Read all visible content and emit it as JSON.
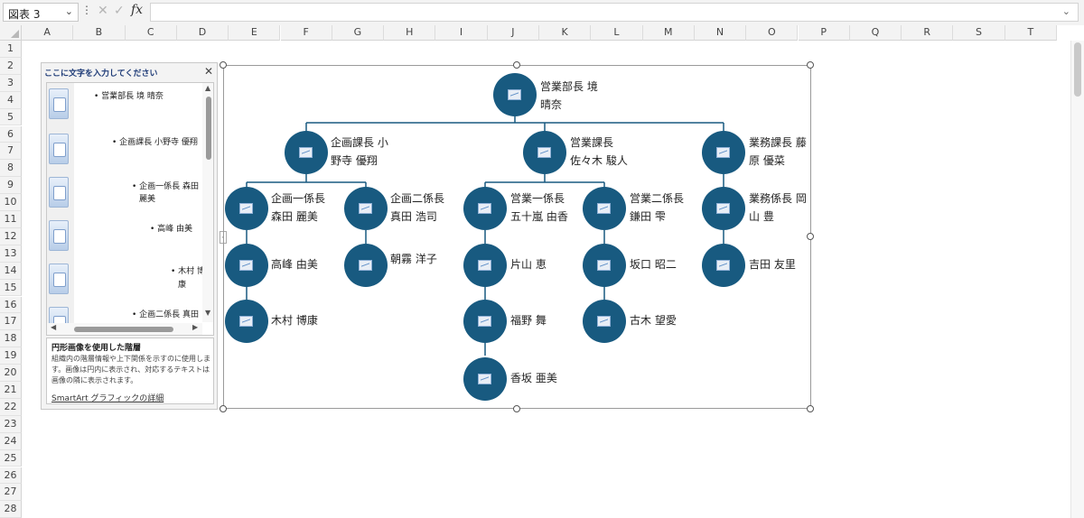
{
  "namebox": {
    "value": "図表 3"
  },
  "formula_bar": {
    "fx_label": "fx",
    "content": ""
  },
  "columns": [
    "A",
    "B",
    "C",
    "D",
    "E",
    "F",
    "G",
    "H",
    "I",
    "J",
    "K",
    "L",
    "M",
    "N",
    "O",
    "P",
    "Q",
    "R",
    "S",
    "T"
  ],
  "rows": [
    "1",
    "2",
    "3",
    "4",
    "5",
    "6",
    "7",
    "8",
    "9",
    "10",
    "11",
    "12",
    "13",
    "14",
    "15",
    "16",
    "17",
    "18",
    "19",
    "20",
    "21",
    "22",
    "23",
    "24",
    "25",
    "26",
    "27",
    "28"
  ],
  "text_pane": {
    "title": "ここに文字を入力してください",
    "items": [
      {
        "text": "営業部長 境 晴奈"
      },
      {
        "text": "企画課長 小野寺 優翔"
      },
      {
        "text": "企画一係長 森田"
      },
      {
        "text": "麗美"
      },
      {
        "text": "高峰 由美"
      },
      {
        "text": "木村 博"
      },
      {
        "text": "康"
      },
      {
        "text": "企画二係長 真田"
      }
    ],
    "desc_title": "円形画像を使用した階層",
    "desc_body": "組織内の階層情報や上下関係を示すのに使用します。画像は円内に表示され、対応するテキストは画像の隣に表示されます。",
    "desc_link": "SmartArt グラフィックの詳細"
  },
  "org_chart": {
    "root": {
      "line1": "営業部長 境",
      "line2": "晴奈"
    },
    "managers": [
      {
        "line1": "企画課長 小",
        "line2": "野寺 優翔"
      },
      {
        "line1": "営業課長",
        "line2": "佐々木 駿人"
      },
      {
        "line1": "業務課長 藤",
        "line2": "原 優菜"
      }
    ],
    "leads": [
      {
        "line1": "企画一係長",
        "line2": "森田 麗美"
      },
      {
        "line1": "企画二係長",
        "line2": "真田 浩司"
      },
      {
        "line1": "営業一係長",
        "line2": "五十嵐 由香"
      },
      {
        "line1": "営業二係長",
        "line2": "鎌田 雫"
      },
      {
        "line1": "業務係長 岡",
        "line2": "山 豊"
      }
    ],
    "staff": {
      "takamine": "高峰 由美",
      "asagiri": "朝霧 洋子",
      "katayama": "片山 恵",
      "sakaguchi": "坂口 昭二",
      "yoshida": "吉田 友里",
      "kimura": "木村 博康",
      "fukuno": "福野 舞",
      "furuki": "古木 望愛",
      "kosaka": "香坂 亜美"
    }
  },
  "colors": {
    "node_fill": "#185a80",
    "pane_title": "#1f3c78"
  },
  "icons": {
    "picture": "picture-placeholder-icon"
  }
}
